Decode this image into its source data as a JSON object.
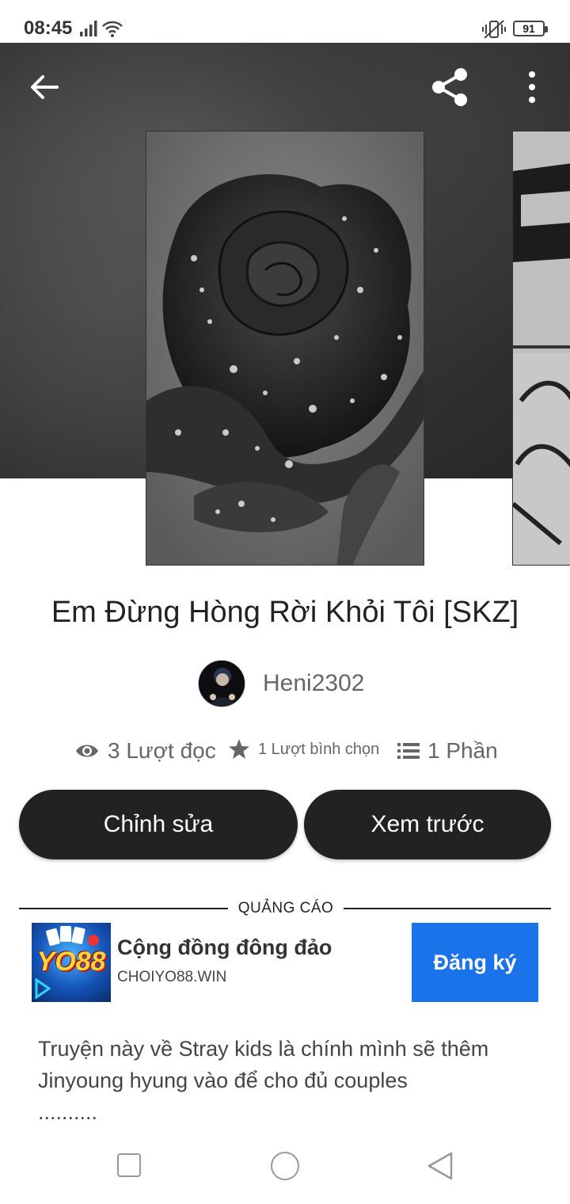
{
  "status_bar": {
    "time": "08:45",
    "battery": "91",
    "icons": [
      "signal-icon",
      "wifi-icon",
      "vibrate-icon",
      "battery-icon"
    ]
  },
  "toolbar": {
    "back_icon": "arrow-left-icon",
    "share_icon": "share-icon",
    "more_icon": "more-vertical-icon"
  },
  "story": {
    "title": "Em Đừng Hòng Rời Khỏi Tôi [SKZ]",
    "author": "Heni2302",
    "stats": {
      "reads": "3 Lượt đọc",
      "votes": "1 Lượt bình chọn",
      "parts": "1 Phần"
    },
    "description_line1": "Truyện này về Stray kids là chính mình sẽ thêm",
    "description_line2": "Jinyoung hyung vào để cho đủ couples",
    "description_line3": ".........."
  },
  "actions": {
    "edit": "Chỉnh sửa",
    "preview": "Xem trước"
  },
  "ad": {
    "label": "QUẢNG CÁO",
    "title": "Cộng đồng đông đảo",
    "domain": "CHOIYO88.WIN",
    "cta": "Đăng ký",
    "logo_text": "YO88"
  },
  "nav": {
    "icons": [
      "recent-apps-icon",
      "home-icon",
      "back-icon"
    ]
  },
  "colors": {
    "button_bg": "#222222",
    "ad_cta": "#1a73e8",
    "hero_bg": "#2f2f2f"
  }
}
